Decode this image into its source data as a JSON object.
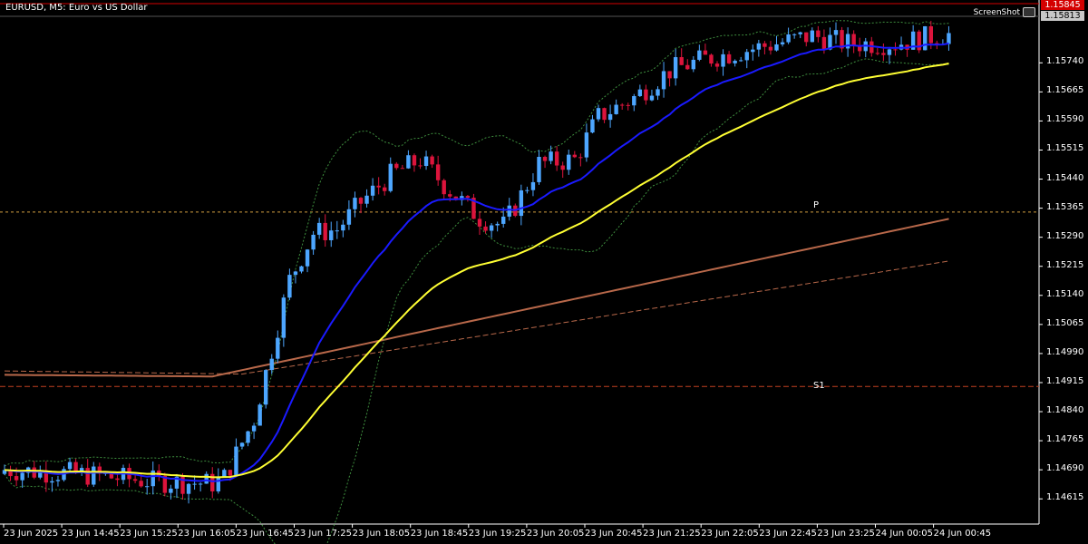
{
  "window": {
    "title": "EURUSD, M5:  Euro vs US Dollar"
  },
  "screenshot_label": "ScreenShot",
  "colors": {
    "background": "#000000",
    "bull": "#4da6ff",
    "bear": "#dc143c",
    "ma_fast": "#1a1aff",
    "ma_slow": "#ffff33",
    "ma_long": "#b8684a",
    "bands": "#3e8e3e",
    "pivot": "#d2a040",
    "support": "#c04020"
  },
  "price_tags": {
    "ask": "1.15845",
    "bid": "1.15813"
  },
  "levels": [
    {
      "name": "P",
      "value": 1.15355
    },
    {
      "name": "S1",
      "value": 1.14905
    }
  ],
  "chart_data": {
    "type": "line",
    "title": "EURUSD, M5:  Euro vs US Dollar",
    "ylim": [
      1.1455,
      1.1586
    ],
    "y_ticks": [
      "1.15740",
      "1.15665",
      "1.15590",
      "1.15515",
      "1.15440",
      "1.15365",
      "1.15290",
      "1.15215",
      "1.15140",
      "1.15065",
      "1.14990",
      "1.14915",
      "1.14840",
      "1.14765",
      "1.14690",
      "1.14615"
    ],
    "x_ticks": [
      "23 Jun 2025",
      "23 Jun 14:45",
      "23 Jun 15:25",
      "23 Jun 16:05",
      "23 Jun 16:45",
      "23 Jun 17:25",
      "23 Jun 18:05",
      "23 Jun 18:45",
      "23 Jun 19:25",
      "23 Jun 20:05",
      "23 Jun 20:45",
      "23 Jun 21:25",
      "23 Jun 22:05",
      "23 Jun 22:45",
      "23 Jun 23:25",
      "24 Jun 00:05",
      "24 Jun 00:45"
    ],
    "close_path": [
      [
        0,
        1.1469
      ],
      [
        12,
        1.1468
      ],
      [
        25,
        1.1466
      ],
      [
        35,
        1.14655
      ],
      [
        37,
        1.1467
      ],
      [
        42,
        1.1482
      ],
      [
        45,
        1.15
      ],
      [
        48,
        1.1518
      ],
      [
        52,
        1.153
      ],
      [
        56,
        1.1531
      ],
      [
        60,
        1.1538
      ],
      [
        65,
        1.1545
      ],
      [
        70,
        1.1549
      ],
      [
        75,
        1.1541
      ],
      [
        80,
        1.1534
      ],
      [
        84,
        1.1532
      ],
      [
        86,
        1.1537
      ],
      [
        90,
        1.1548
      ],
      [
        96,
        1.1549
      ],
      [
        100,
        1.156
      ],
      [
        106,
        1.1565
      ],
      [
        112,
        1.1572
      ],
      [
        118,
        1.1575
      ],
      [
        124,
        1.1577
      ],
      [
        130,
        1.1579
      ],
      [
        136,
        1.1581
      ],
      [
        142,
        1.1579
      ],
      [
        150,
        1.1579
      ],
      [
        158,
        1.15813
      ]
    ],
    "series": [
      {
        "kind": "candles"
      },
      {
        "kind": "ma_fast"
      },
      {
        "kind": "ma_slow"
      },
      {
        "kind": "ma_long"
      },
      {
        "kind": "ma_long_dashed"
      },
      {
        "kind": "bollinger"
      }
    ]
  }
}
